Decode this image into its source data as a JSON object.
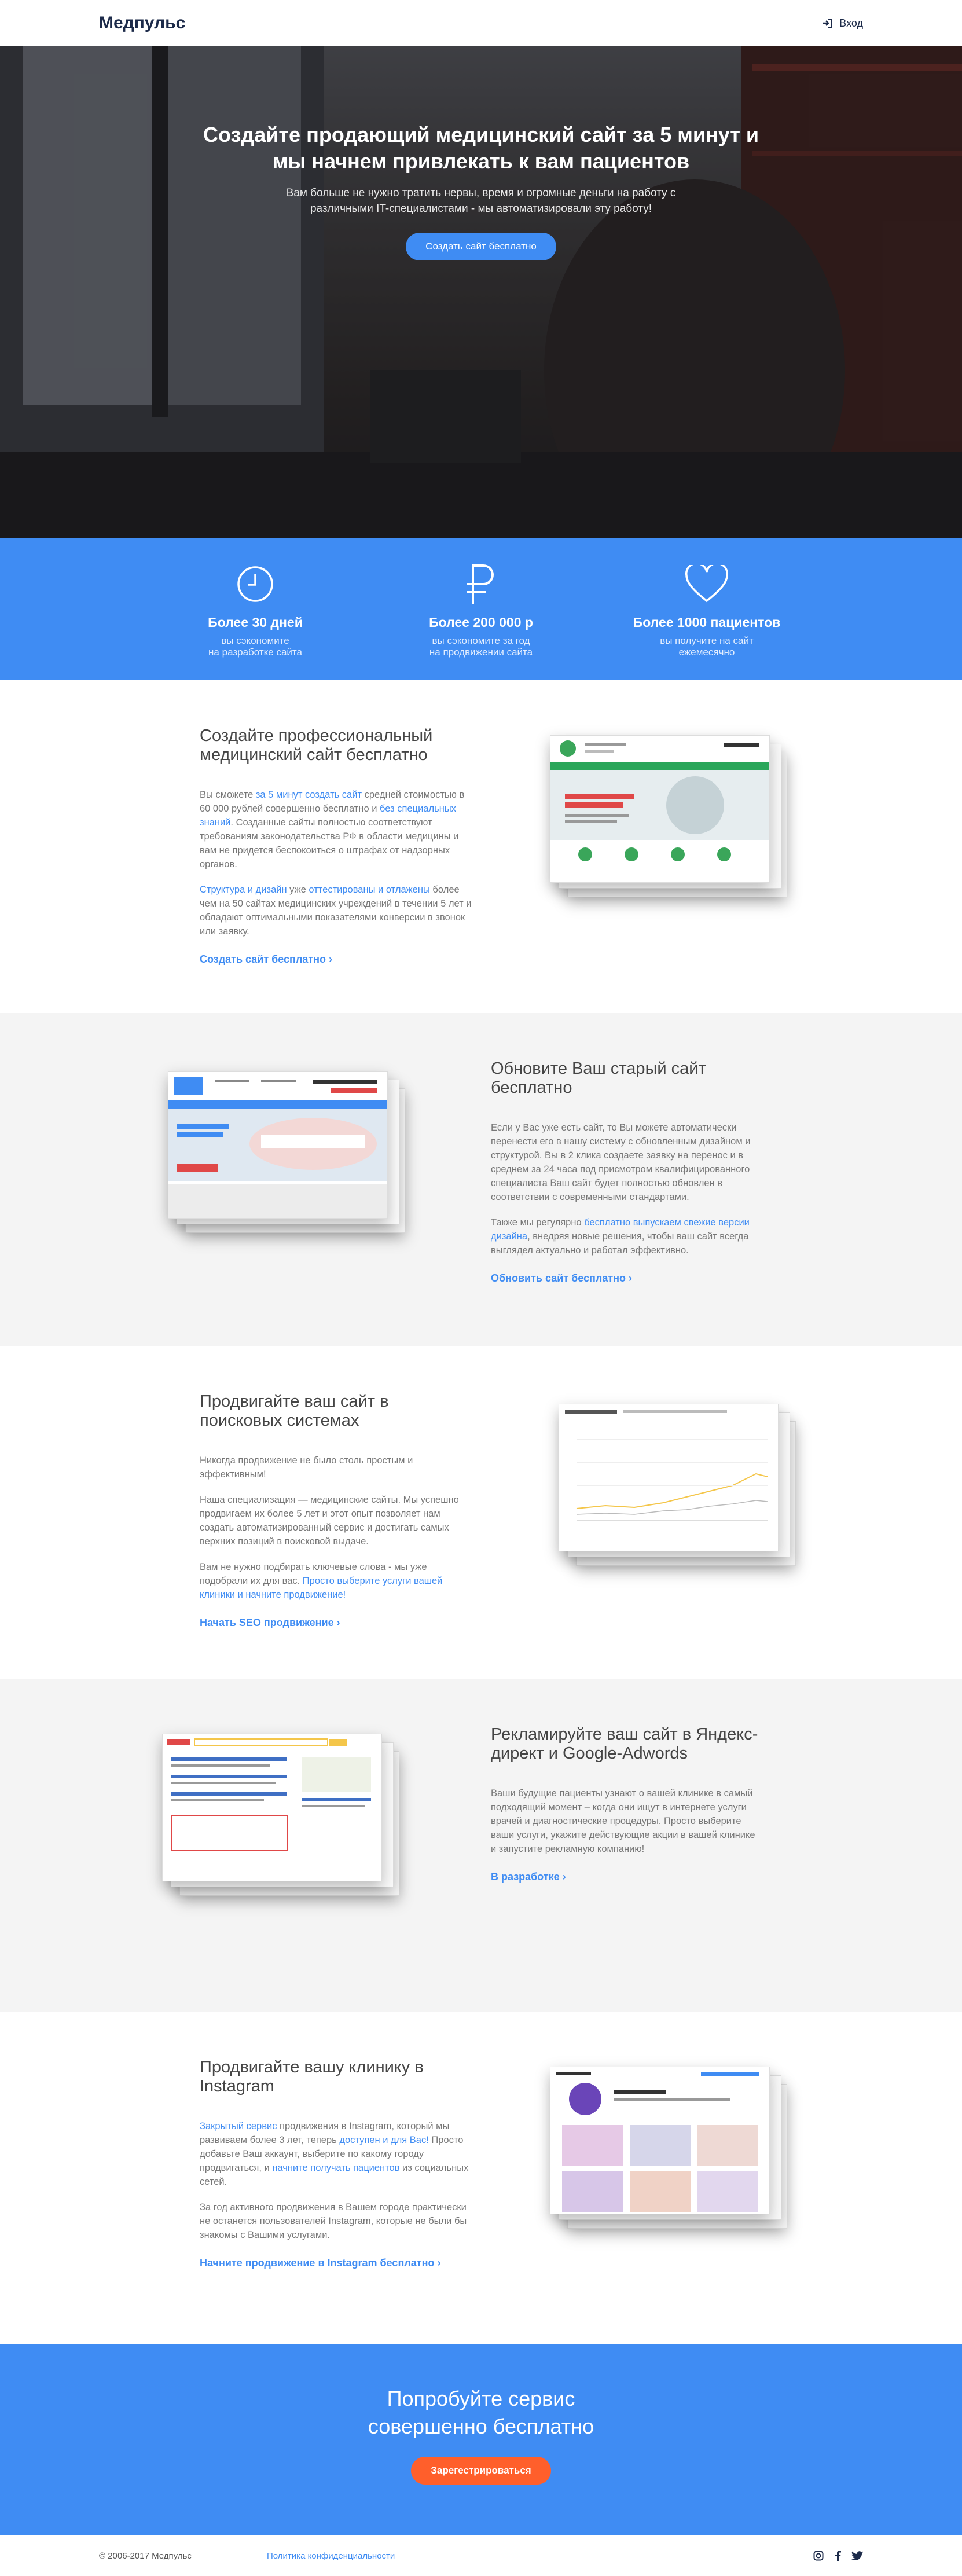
{
  "header": {
    "logo": "Медпульс",
    "login": "Вход"
  },
  "hero": {
    "title": "Создайте продающий медицинский сайт за 5 минут и мы начнем привлекать к вам пациентов",
    "subtitle": "Вам больше не нужно тратить нервы, время и огромные деньги на работу с различными IT-специалистами - мы автоматизировали эту работу!",
    "button": "Создать сайт бесплатно"
  },
  "stats": [
    {
      "icon": "clock-icon",
      "title": "Более 30 дней",
      "desc1": "вы сэкономите",
      "desc2": "на разработке сайта"
    },
    {
      "icon": "ruble-icon",
      "title": "Более 200 000 р",
      "desc1": "вы сэкономите за год",
      "desc2": "на продвижении сайта"
    },
    {
      "icon": "heart-icon",
      "title": "Более 1000 пациентов",
      "desc1": "вы получите на сайт",
      "desc2": "ежемесячно"
    }
  ],
  "sections": [
    {
      "title": "Создайте профессиональный медицинский сайт бесплатно",
      "p1_a": "Вы сможете ",
      "p1_link1": "за 5 минут создать сайт",
      "p1_b": " средней стоимостью в 60 000 рублей совершенно бесплатно и ",
      "p1_link2": "без специальных знаний",
      "p1_c": ". Созданные сайты полностью соответствуют требованиям законодательства РФ в области медицины и вам не придется беспокоиться о штрафах от надзорных органов.",
      "p2_link1": "Структура и дизайн",
      "p2_a": " уже ",
      "p2_link2": "оттестированы и отлажены",
      "p2_b": " более чем на 50 сайтах медицинских учреждений в течении 5 лет и обладают оптимальными показателями конверсии в звонок или заявку.",
      "cta": "Создать сайт бесплатно"
    },
    {
      "title": "Обновите Ваш старый сайт бесплатно",
      "p1": "Если у Вас уже есть сайт, то Вы можете автоматически перенести его в нашу систему с обновленным дизайном и структурой. Вы в 2 клика создаете заявку на перенос и в среднем за 24 часа под присмотром квалифицированного специалиста Ваш сайт будет полностью обновлен в соответствии с современными стандартами.",
      "p2_a": "Также мы регулярно ",
      "p2_link": "бесплатно выпускаем свежие версии дизайна",
      "p2_b": ", внедряя новые решения, чтобы ваш сайт всегда выглядел актуально и работал эффективно.",
      "cta": "Обновить сайт бесплатно"
    },
    {
      "title": "Продвигайте ваш сайт в поисковых системах",
      "p1": "Никогда продвижение не было столь простым и эффективным!",
      "p2": "Наша специализация — медицинские сайты. Мы успешно продвигаем их более 5 лет и этот опыт позволяет нам создать автоматизированный сервис и достигать самых верхних позиций в поисковой выдаче.",
      "p3_a": "Вам не нужно подбирать ключевые слова - мы уже подобрали их для вас. ",
      "p3_link": "Просто выберите услуги вашей клиники и начните продвижение!",
      "cta": "Начать SEO продвижение"
    },
    {
      "title": "Рекламируйте ваш сайт в Яндекс-директ и Google-Adwords",
      "p1": "Ваши будущие пациенты узнают о вашей клинике в самый подходящий момент – когда они ищут в интернете услуги врачей и диагностические процедуры. Просто выберите ваши услуги, укажите действующие акции в вашей клинике и запустите рекламную компанию!",
      "cta": "В разработке"
    },
    {
      "title": "Продвигайте вашу клинику в Instagram",
      "p1_link1": "Закрытый сервис",
      "p1_a": " продвижения в Instagram, который мы развиваем более 3 лет, теперь ",
      "p1_link2": "доступен и для Вас!",
      "p1_b": " Просто добавьте Ваш аккаунт, выберите по какому городу продвигаться, и ",
      "p1_link3": "начните получать пациентов",
      "p1_c": " из социальных сетей.",
      "p2": "За год активного продвижения в Вашем городе практически не останется пользователей Instagram, которые не были бы знакомы с Вашими услугами.",
      "cta": "Начните продвижение в Instagram бесплатно"
    }
  ],
  "banner": {
    "title1": "Попробуйте сервис",
    "title2": "совершенно бесплатно",
    "button": "Зарегестрироваться"
  },
  "footer": {
    "copy": "© 2006-2017 Медпульс",
    "policy": "Политика конфиденциальности"
  },
  "colors": {
    "accent": "#3f8cf3",
    "orange": "#ff5f2b",
    "dark": "#1d2b4a"
  }
}
